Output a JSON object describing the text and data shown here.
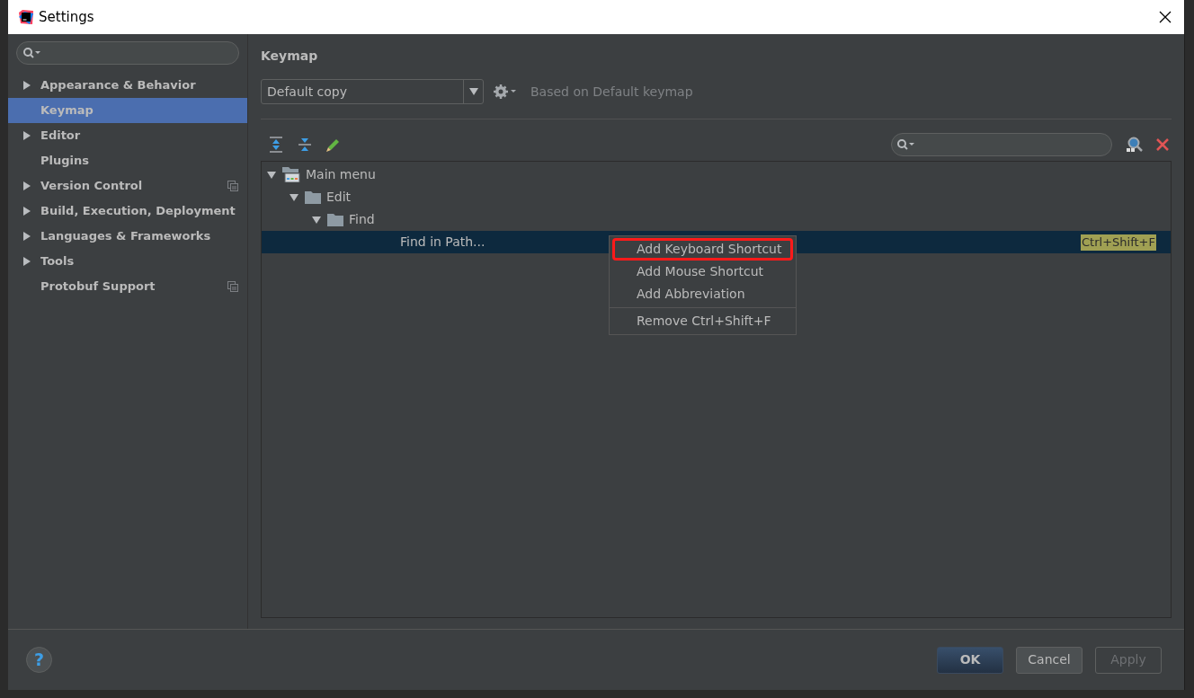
{
  "window": {
    "title": "Settings"
  },
  "sidebar": {
    "items": [
      {
        "label": "Appearance & Behavior",
        "expandable": true,
        "selected": false,
        "project_scoped": false
      },
      {
        "label": "Keymap",
        "expandable": false,
        "selected": true,
        "project_scoped": false
      },
      {
        "label": "Editor",
        "expandable": true,
        "selected": false,
        "project_scoped": false
      },
      {
        "label": "Plugins",
        "expandable": false,
        "selected": false,
        "project_scoped": false
      },
      {
        "label": "Version Control",
        "expandable": true,
        "selected": false,
        "project_scoped": true
      },
      {
        "label": "Build, Execution, Deployment",
        "expandable": true,
        "selected": false,
        "project_scoped": false
      },
      {
        "label": "Languages & Frameworks",
        "expandable": true,
        "selected": false,
        "project_scoped": false
      },
      {
        "label": "Tools",
        "expandable": true,
        "selected": false,
        "project_scoped": false
      },
      {
        "label": "Protobuf Support",
        "expandable": false,
        "selected": false,
        "project_scoped": true
      }
    ]
  },
  "panel": {
    "title": "Keymap",
    "keymap_select": {
      "value": "Default copy"
    },
    "based_on": "Based on Default keymap"
  },
  "tree": [
    {
      "label": "Main menu",
      "kind": "menu",
      "expanded": true,
      "selected": false,
      "children": [
        {
          "label": "Edit",
          "kind": "folder",
          "expanded": true,
          "selected": false,
          "children": [
            {
              "label": "Find",
              "kind": "folder",
              "expanded": true,
              "selected": false,
              "children": [
                {
                  "label": "Find in Path...",
                  "kind": "action",
                  "selected": true,
                  "shortcut": "Ctrl+Shift+F"
                }
              ]
            }
          ]
        }
      ]
    }
  ],
  "context_menu": [
    {
      "kind": "item",
      "label": "Add Keyboard Shortcut",
      "outlined": true
    },
    {
      "kind": "item",
      "label": "Add Mouse Shortcut",
      "outlined": false
    },
    {
      "kind": "item",
      "label": "Add Abbreviation",
      "outlined": false
    },
    {
      "kind": "separator"
    },
    {
      "kind": "item",
      "label": "Remove Ctrl+Shift+F",
      "outlined": false
    }
  ],
  "help": {
    "label": "?"
  },
  "buttons": [
    {
      "label": "OK",
      "default": true,
      "disabled": false
    },
    {
      "label": "Cancel",
      "default": false,
      "disabled": false
    },
    {
      "label": "Apply",
      "default": false,
      "disabled": true
    }
  ]
}
